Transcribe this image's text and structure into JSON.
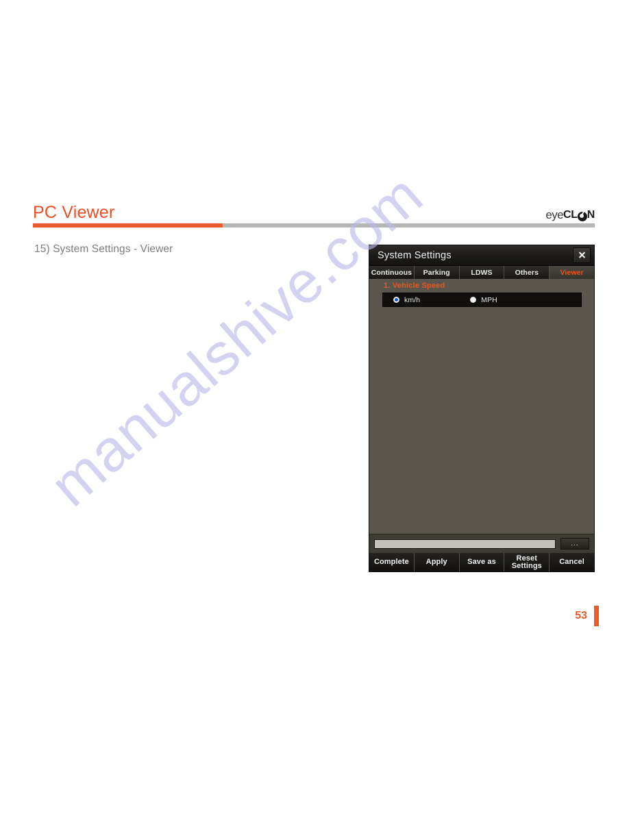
{
  "page": {
    "header_title": "PC Viewer",
    "section_caption": "15) System Settings - Viewer",
    "page_number": "53",
    "accent_color": "#ea5a2a",
    "rule_color": "#b6b6b6",
    "watermark_text": "manualshive.com"
  },
  "logo": {
    "part1": "eye",
    "part2": "CL",
    "o_icon": "logo-eye-circle-icon",
    "part3": "N"
  },
  "dialog": {
    "title": "System Settings",
    "close_icon": "close-icon",
    "tabs": [
      {
        "label": "Continuous",
        "active": false
      },
      {
        "label": "Parking",
        "active": false
      },
      {
        "label": "LDWS",
        "active": false
      },
      {
        "label": "Others",
        "active": false
      },
      {
        "label": "Viewer",
        "active": true
      }
    ],
    "section": {
      "label": "1. Vehicle Speed",
      "options": [
        {
          "label": "km/h",
          "selected": true
        },
        {
          "label": "MPH",
          "selected": false
        }
      ]
    },
    "path": {
      "value": "",
      "placeholder": "",
      "browse_label": "..."
    },
    "footer_buttons": [
      {
        "label": "Complete",
        "lines": [
          "Complete"
        ]
      },
      {
        "label": "Apply",
        "lines": [
          "Apply"
        ]
      },
      {
        "label": "Save as",
        "lines": [
          "Save as"
        ]
      },
      {
        "label": "Reset Settings",
        "lines": [
          "Reset",
          "Settings"
        ]
      },
      {
        "label": "Cancel",
        "lines": [
          "Cancel"
        ]
      }
    ]
  }
}
